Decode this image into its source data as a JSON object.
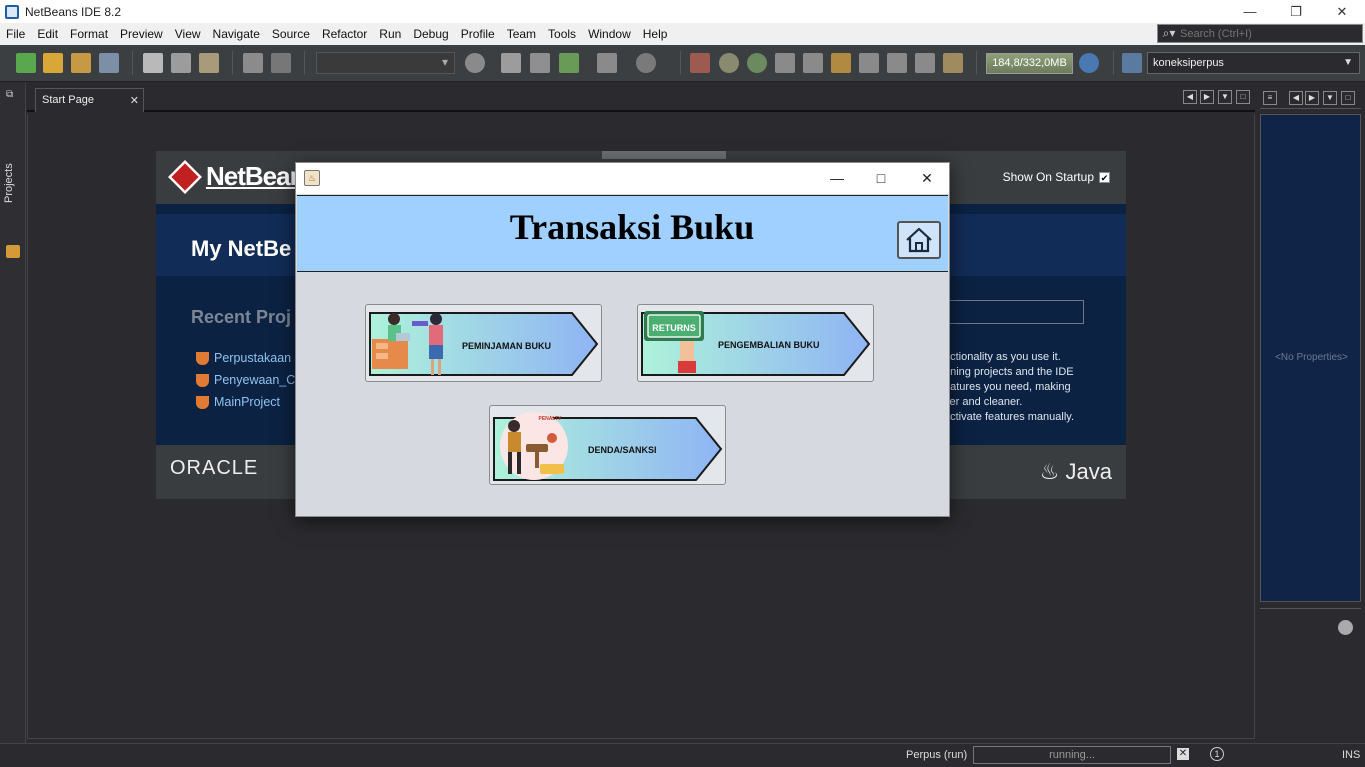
{
  "window": {
    "title": "NetBeans IDE 8.2"
  },
  "menu": [
    "File",
    "Edit",
    "Format",
    "Preview",
    "View",
    "Navigate",
    "Source",
    "Refactor",
    "Run",
    "Debug",
    "Profile",
    "Team",
    "Tools",
    "Window",
    "Help"
  ],
  "search": {
    "placeholder": "Search (Ctrl+I)"
  },
  "toolbar": {
    "memory": "184,8/332,0MB",
    "connection": "koneksiperpus"
  },
  "left_strip": {
    "projects_label": "Projects"
  },
  "editor": {
    "tab_label": "Start Page"
  },
  "start_page": {
    "brand": "NetBeans",
    "show_on_startup": "Show On Startup",
    "my_netbeans": "My NetBe",
    "recent_projects": "Recent Proj",
    "projects": [
      "Perpustakaan",
      "Penyewaan_C",
      "MainProject"
    ],
    "info_lines": [
      "nctionality as you use it.",
      "ening projects and the IDE",
      "eatures you need, making",
      "ker and cleaner.",
      "activate features manually."
    ],
    "oracle": "ORACLE",
    "java": "Java"
  },
  "right_panel": {
    "no_properties": "<No Properties>"
  },
  "status": {
    "run_label": "Perpus (run)",
    "progress": "running...",
    "notifications": "1",
    "mode": "INS"
  },
  "dialog": {
    "title": "Transaksi Buku",
    "buttons": {
      "peminjaman": "PEMINJAMAN BUKU",
      "pengembalian": "PENGEMBALIAN BUKU",
      "denda": "DENDA/SANKSI"
    },
    "returns_sign": "RETURNS",
    "penalty_sign": "PENALTY"
  }
}
